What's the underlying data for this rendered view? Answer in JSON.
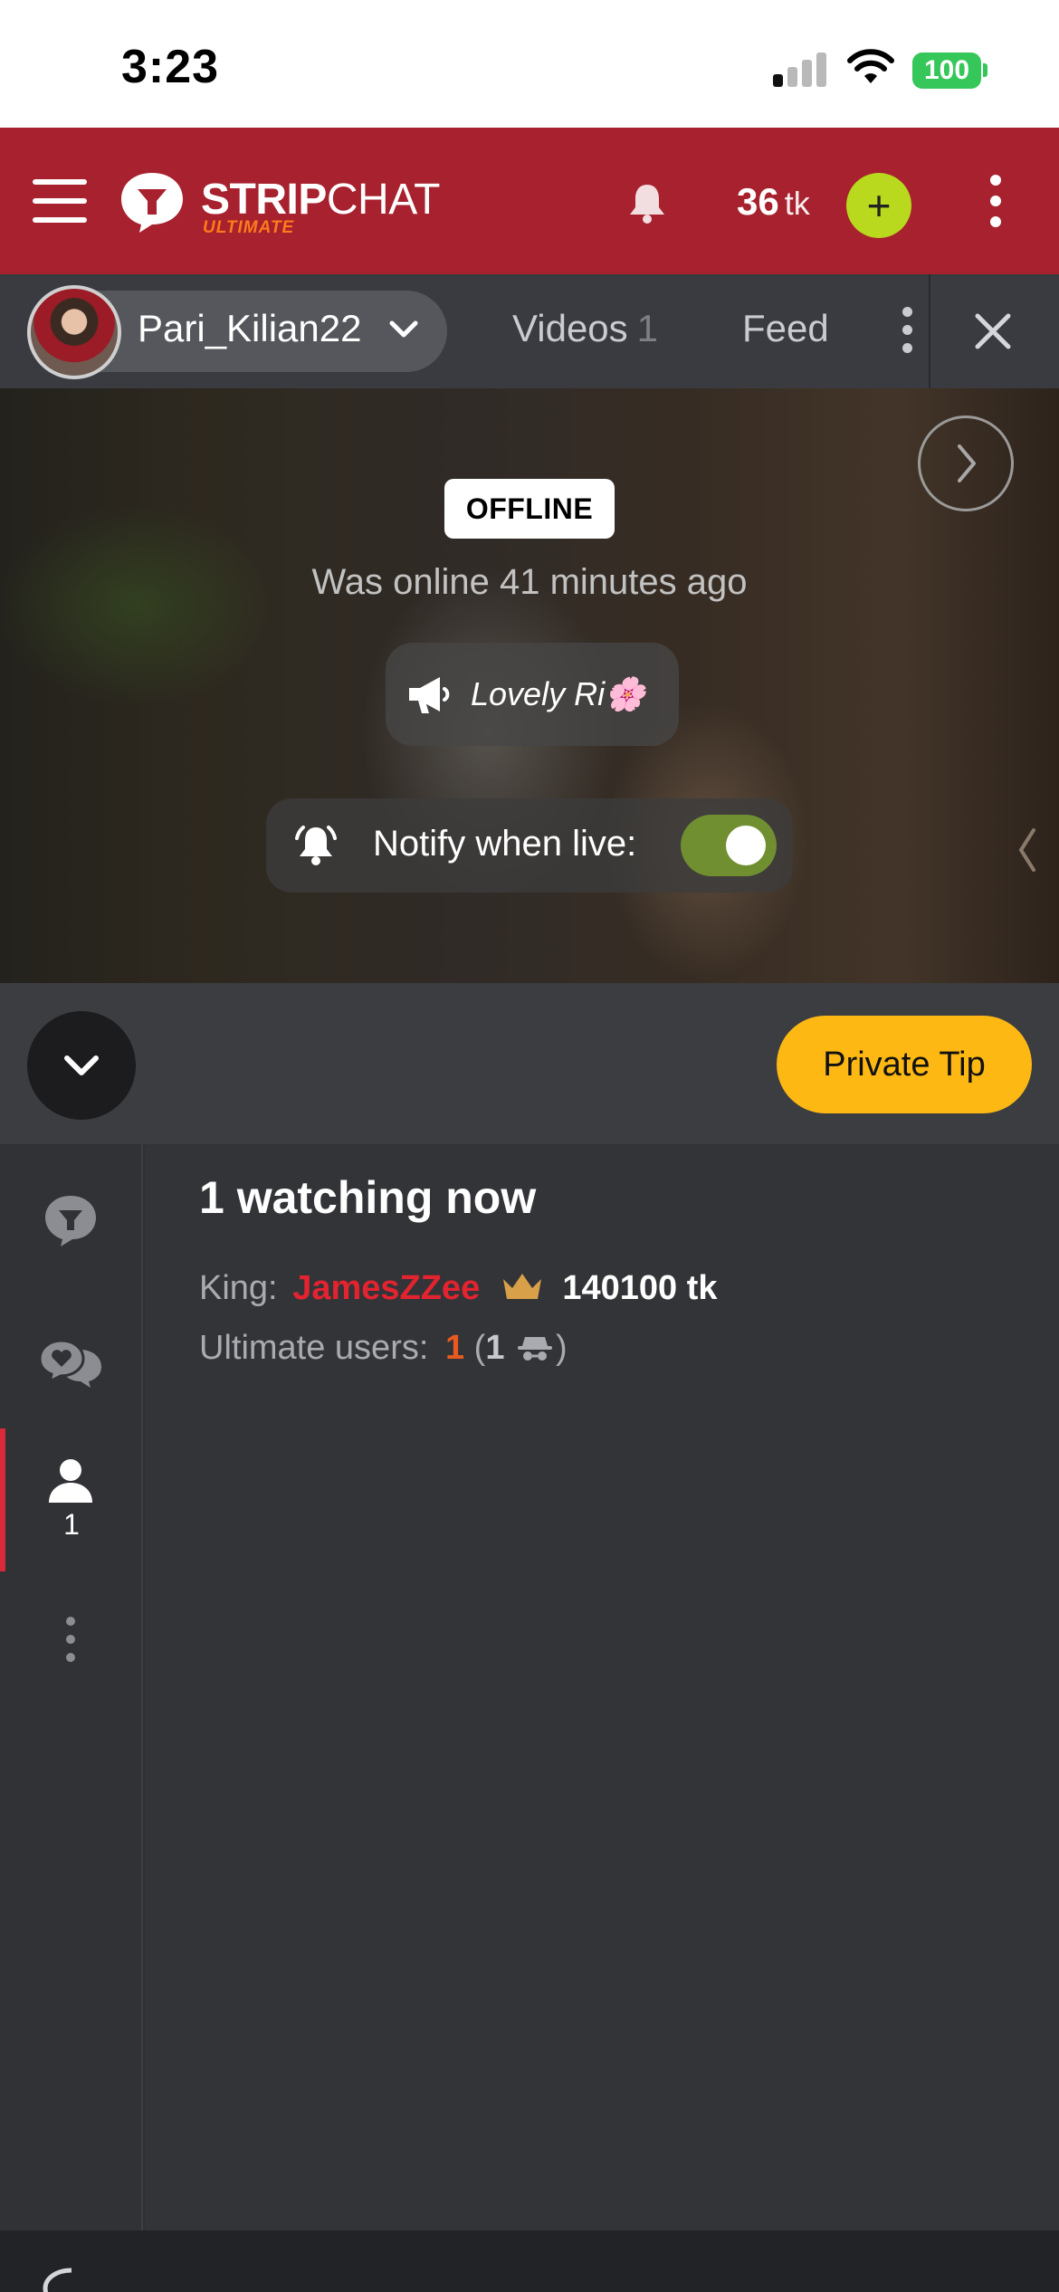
{
  "status_bar": {
    "time": "3:23",
    "battery": "100"
  },
  "header": {
    "logo_main": "STRIP",
    "logo_light": "CHAT",
    "logo_sub": "ULTIMATE",
    "token_balance": "36",
    "token_unit": "tk",
    "add_label": "+"
  },
  "profile_bar": {
    "model_name": "Pari_Kilian22",
    "tabs": [
      {
        "label": "Videos",
        "count": "1"
      },
      {
        "label": "Feed"
      }
    ]
  },
  "video": {
    "status_badge": "OFFLINE",
    "last_seen": "Was online 41 minutes ago",
    "topic": "Lovely Ri🌸",
    "notify_label": "Notify when live:",
    "notify_enabled": true
  },
  "controls": {
    "private_tip_label": "Private Tip"
  },
  "rail": {
    "users_count": "1"
  },
  "users_panel": {
    "watching": "1 watching now",
    "king_label": "King:",
    "king_name": "JamesZZee",
    "king_tokens": "140100 tk",
    "ultimate_label": "Ultimate users:",
    "ultimate_count": "1",
    "anonymous_open": "(",
    "anonymous_count": "1",
    "anonymous_close": ")"
  },
  "colors": {
    "brand_red": "#a7212e",
    "add_button": "#b8d91e",
    "private_tip": "#fdb813",
    "king_name": "#e3232f",
    "ultimate_count": "#e85a1f",
    "toggle_on": "#6f8f31"
  },
  "icons": {
    "menu": "hamburger-icon",
    "logo": "stripchat-logo-icon",
    "notifications": "bell-icon",
    "more": "kebab-icon",
    "close": "close-icon",
    "next": "chevron-right-icon",
    "announcement": "megaphone-icon",
    "notify": "bell-ring-icon",
    "collapse": "chevron-down-icon",
    "chat": "chat-icon",
    "private_chat": "private-chat-icon",
    "users": "user-icon",
    "king": "crown-icon",
    "anonymous": "spy-icon"
  }
}
